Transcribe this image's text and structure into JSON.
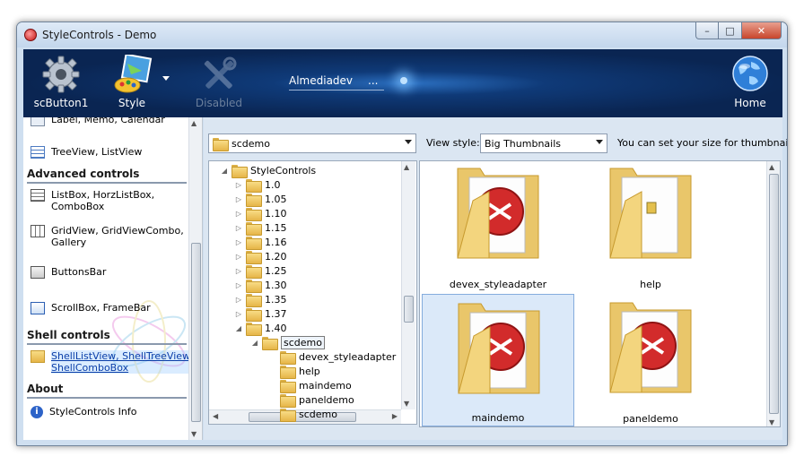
{
  "window": {
    "title": "StyleControls - Demo",
    "min": "–",
    "max": "□",
    "close": "✕"
  },
  "toolbar": {
    "button1": "scButton1",
    "style": "Style",
    "disabled": "Disabled",
    "edit_value": "Almediadev",
    "edit_dots": "...",
    "home": "Home"
  },
  "left_panel": {
    "cut_top": "Label, Memo, Calendar",
    "treeview": "TreeView, ListView",
    "advanced_head": "Advanced controls",
    "listbox": "ListBox, HorzListBox,",
    "listbox2": "ComboBox",
    "gridview": "GridView, GridViewCombo,",
    "gridview2": "Gallery",
    "buttonsbar": "ButtonsBar",
    "scrollbox": "ScrollBox, FrameBar",
    "shell_head": "Shell controls",
    "shell1": "ShellListView, ShellTreeView,",
    "shell2": "ShellComboBox",
    "about_head": "About",
    "info": "StyleControls Info"
  },
  "content": {
    "path_combo": "scdemo",
    "view_style_label": "View style:",
    "view_style_value": "Big Thumbnails",
    "hint": "You can set your size for thumbnails!",
    "tree": {
      "root": "StyleControls",
      "versions": [
        "1.0",
        "1.05",
        "1.10",
        "1.15",
        "1.16",
        "1.20",
        "1.25",
        "1.30",
        "1.35",
        "1.37",
        "1.40"
      ],
      "selected": "scdemo",
      "children": [
        "devex_styleadapter",
        "help",
        "maindemo",
        "paneldemo",
        "scdemo"
      ]
    },
    "thumbs": [
      "devex_styleadapter",
      "help",
      "maindemo",
      "paneldemo"
    ]
  }
}
